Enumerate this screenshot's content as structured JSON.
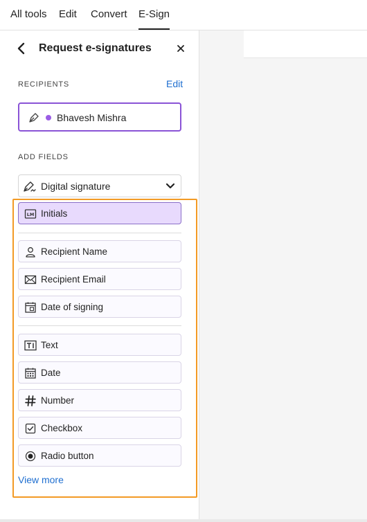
{
  "nav": {
    "tabs": [
      {
        "label": "All tools"
      },
      {
        "label": "Edit"
      },
      {
        "label": "Convert"
      },
      {
        "label": "E-Sign"
      }
    ],
    "active_tab": "E-Sign"
  },
  "panel": {
    "title": "Request e-signatures",
    "recipients": {
      "label": "RECIPIENTS",
      "edit_label": "Edit",
      "recipient_name": "Bhavesh Mishra",
      "recipient_color": "#9b5de5"
    },
    "add_fields": {
      "label": "ADD FIELDS",
      "selected_type": "Digital signature",
      "fields": [
        {
          "label": "Initials",
          "icon": "initials-icon"
        },
        {
          "label": "Recipient Name",
          "icon": "person-icon"
        },
        {
          "label": "Recipient Email",
          "icon": "envelope-icon"
        },
        {
          "label": "Date of signing",
          "icon": "calendar-signing-icon"
        },
        {
          "label": "Text",
          "icon": "text-field-icon"
        },
        {
          "label": "Date",
          "icon": "calendar-icon"
        },
        {
          "label": "Number",
          "icon": "hash-icon"
        },
        {
          "label": "Checkbox",
          "icon": "checkbox-icon"
        },
        {
          "label": "Radio button",
          "icon": "radio-icon"
        }
      ],
      "view_more": "View more"
    }
  },
  "colors": {
    "accent_blue": "#1f6fd0",
    "highlight_orange": "#f39a24",
    "selected_field_bg": "#e8dafd",
    "recipient_border": "#8a53d6"
  }
}
